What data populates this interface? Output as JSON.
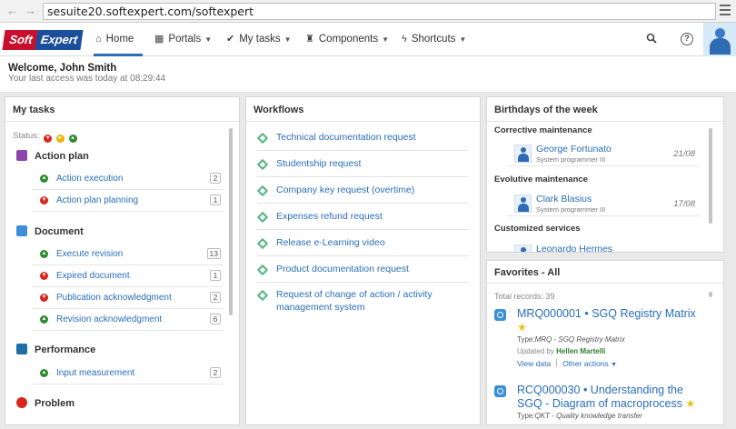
{
  "browser": {
    "url": "sesuite20.softexpert.com/softexpert"
  },
  "logo": {
    "part1": "Soft",
    "part2": "Expert"
  },
  "nav": {
    "home": "Home",
    "portals": "Portals",
    "my_tasks": "My tasks",
    "components": "Components",
    "shortcuts": "Shortcuts"
  },
  "welcome": {
    "title": "Welcome, John Smith",
    "subtitle": "Your last access was today at 08:29:44"
  },
  "my_tasks": {
    "title": "My tasks",
    "status_label": "Status:",
    "categories": [
      {
        "name": "Action plan",
        "color": "#8e44ad",
        "items": [
          {
            "label": "Action execution",
            "status": "up",
            "count": "2"
          },
          {
            "label": "Action plan planning",
            "status": "down",
            "count": "1"
          }
        ]
      },
      {
        "name": "Document",
        "color": "#3a8fd6",
        "items": [
          {
            "label": "Execute revision",
            "status": "up",
            "count": "13"
          },
          {
            "label": "Expired document",
            "status": "down",
            "count": "1"
          },
          {
            "label": "Publication acknowledgment",
            "status": "down",
            "count": "2"
          },
          {
            "label": "Revision acknowledgment",
            "status": "up",
            "count": "6"
          }
        ]
      },
      {
        "name": "Performance",
        "color": "#1d6fa5",
        "items": [
          {
            "label": "Input measurement",
            "status": "up",
            "count": "2"
          }
        ]
      },
      {
        "name": "Problem",
        "color": "#d9261c",
        "items": []
      }
    ]
  },
  "workflows": {
    "title": "Workflows",
    "items": [
      "Technical documentation request",
      "Studentship request",
      "Company key request (overtime)",
      "Expenses refund request",
      "Release e-Learning video",
      "Product documentation request",
      "Request of change of action / activity management system"
    ]
  },
  "birthdays": {
    "title": "Birthdays of the week",
    "sections": [
      {
        "name": "Corrective maintenance",
        "people": [
          {
            "name": "George Fortunato",
            "role": "System programmer III",
            "date": "21/08"
          }
        ]
      },
      {
        "name": "Evolutive maintenance",
        "people": [
          {
            "name": "Clark Blasius",
            "role": "System programmer III",
            "date": "17/08"
          }
        ]
      },
      {
        "name": "Customized services",
        "people": [
          {
            "name": "Leonardo Hermes",
            "role": "",
            "date": ""
          }
        ]
      }
    ]
  },
  "favorites": {
    "title": "Favorites - All",
    "total": "Total records: 39",
    "items": [
      {
        "title": "MRQ000001 • SGQ Registry Matrix",
        "type_prefix": "Type:",
        "type": "MRQ - SGQ Registry Matrix",
        "updated_prefix": "Updated by",
        "updated_by": "Hellen Martelli",
        "view": "View data",
        "other": "Other actions"
      },
      {
        "title": "RCQ000030 • Understanding the SGQ - Diagram of macroprocess",
        "type_prefix": "Type:",
        "type": "QKT - Quality knowledge transfer"
      }
    ]
  }
}
